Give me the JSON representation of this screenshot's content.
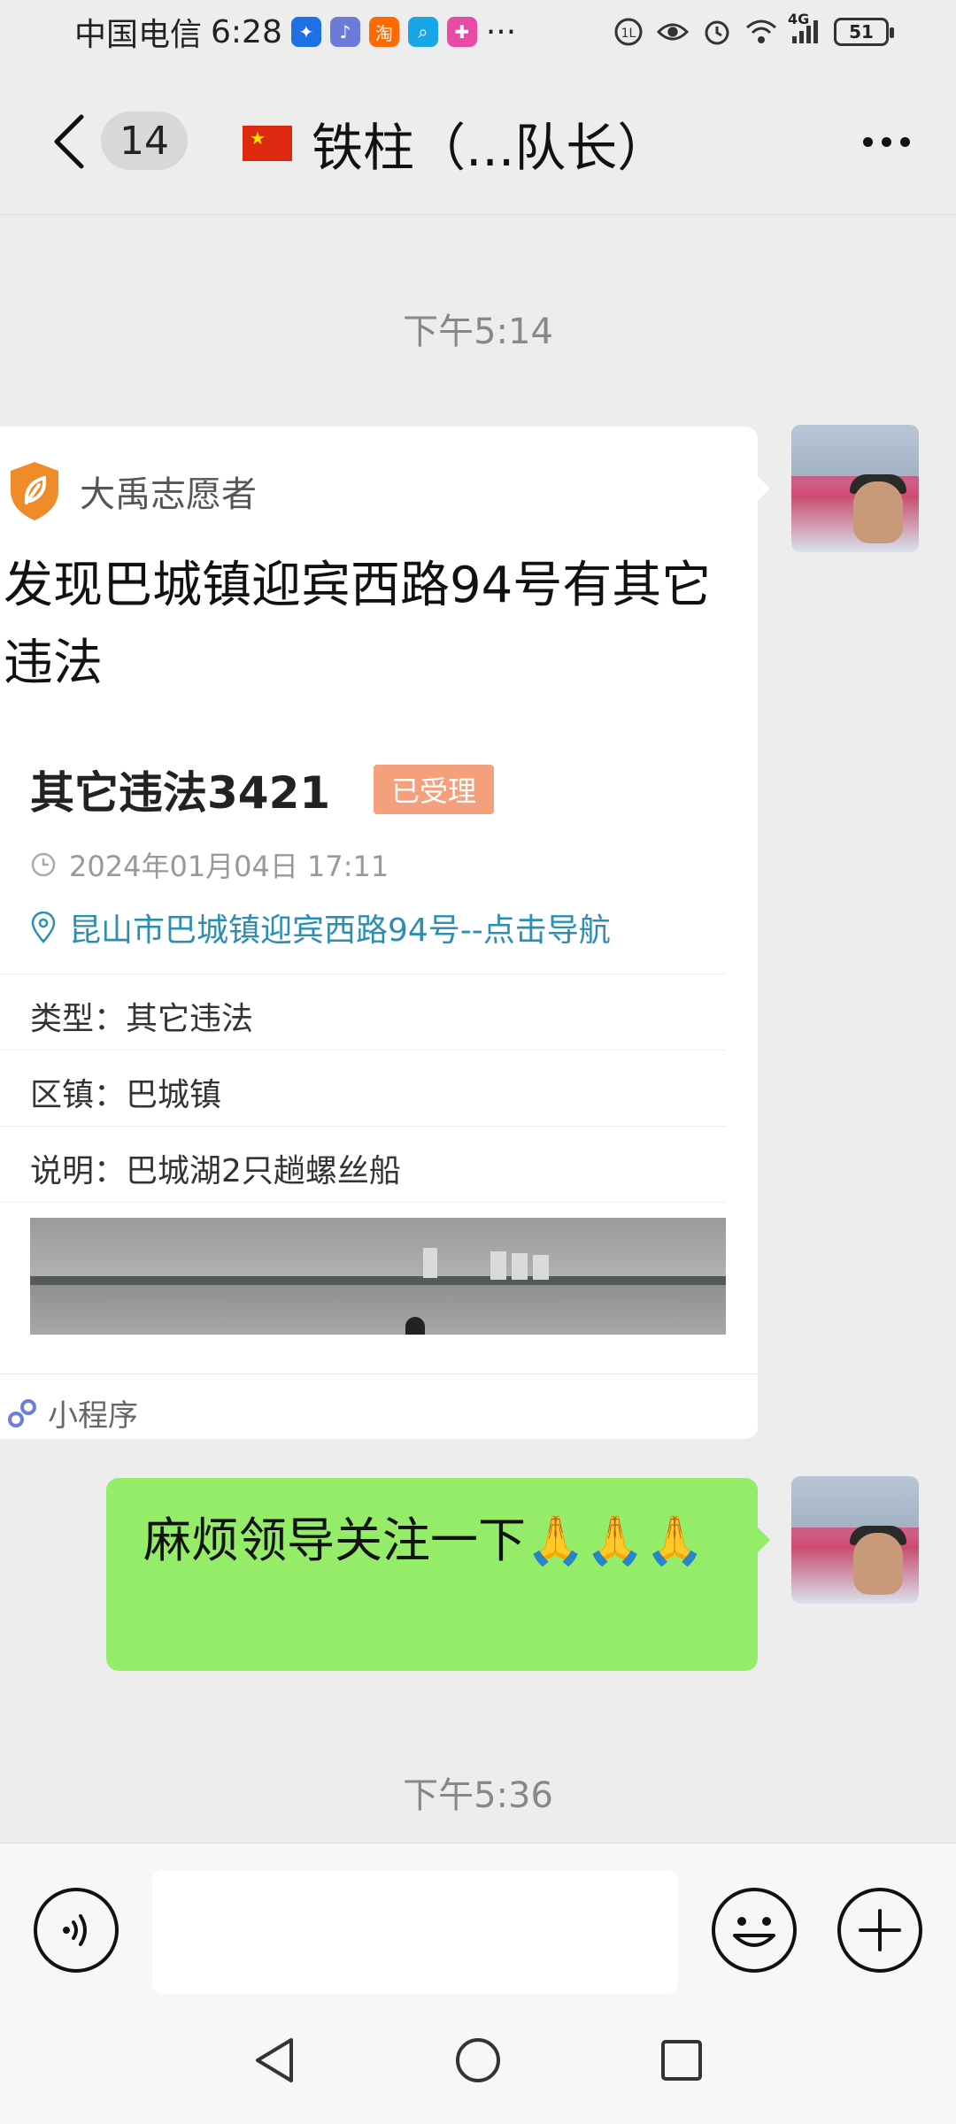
{
  "status_bar": {
    "carrier": "中国电信",
    "time": "6:28",
    "more": "···",
    "network": "4G",
    "battery": "51"
  },
  "header": {
    "unread_count": "14",
    "title": "铁柱（...队长）"
  },
  "messages": {
    "time_1": "下午5:14",
    "time_2": "下午5:36",
    "card": {
      "source": "大禹志愿者",
      "title": "发现巴城镇迎宾西路94号有其它违法",
      "case_name": "其它违法3421",
      "status": "已受理",
      "datetime": "2024年01月04日 17:11",
      "address": "昆山市巴城镇迎宾西路94号--点击导航",
      "fields": [
        {
          "label": "类型：",
          "value": "其它违法"
        },
        {
          "label": "区镇：",
          "value": "巴城镇"
        },
        {
          "label": "说明：",
          "value": "巴城湖2只趟螺丝船"
        }
      ],
      "footer": "小程序"
    },
    "text_message": "麻烦领导关注一下🙏🙏🙏"
  },
  "input": {
    "placeholder": ""
  },
  "colors": {
    "bubble_green": "#95ec69",
    "link_blue": "#2b8fb3",
    "status_orange": "#f5a07c",
    "background": "#ededed"
  }
}
